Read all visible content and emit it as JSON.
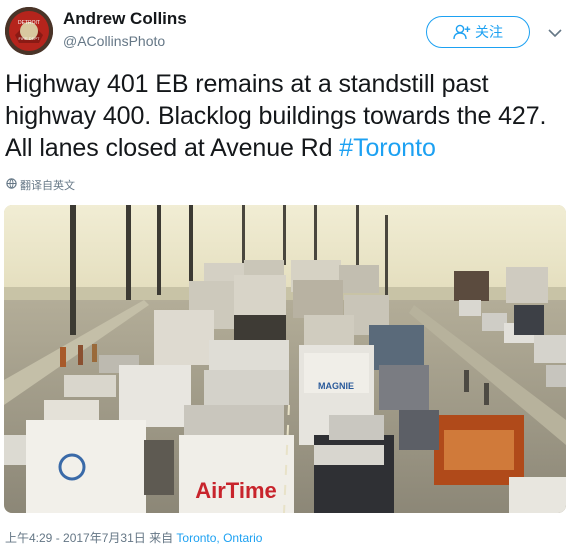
{
  "author": {
    "display_name": "Andrew Collins",
    "handle": "@ACollinsPhoto",
    "avatar_text": "DETROIT FIRE DEPARTMENT"
  },
  "follow_button": {
    "label": "关注"
  },
  "tweet": {
    "text": "Highway 401 EB remains at a standstill past highway 400. Blacklog  buildings towards the 427. All lanes closed at Avenue Rd ",
    "hashtag": "#Toronto"
  },
  "translate_label": "翻译自英文",
  "media": {
    "alt": "Traffic jam on Highway 401 with trucks and cars stopped",
    "truck_labels": {
      "airtime": "AirTime",
      "magnie": "MAGNIE"
    }
  },
  "footer": {
    "timestamp": "上午4:29 - 2017年7月31日 来自 ",
    "place": "Toronto, Ontario"
  },
  "colors": {
    "link": "#1da1f2",
    "secondary_text": "#657786",
    "primary_text": "#14171a"
  }
}
